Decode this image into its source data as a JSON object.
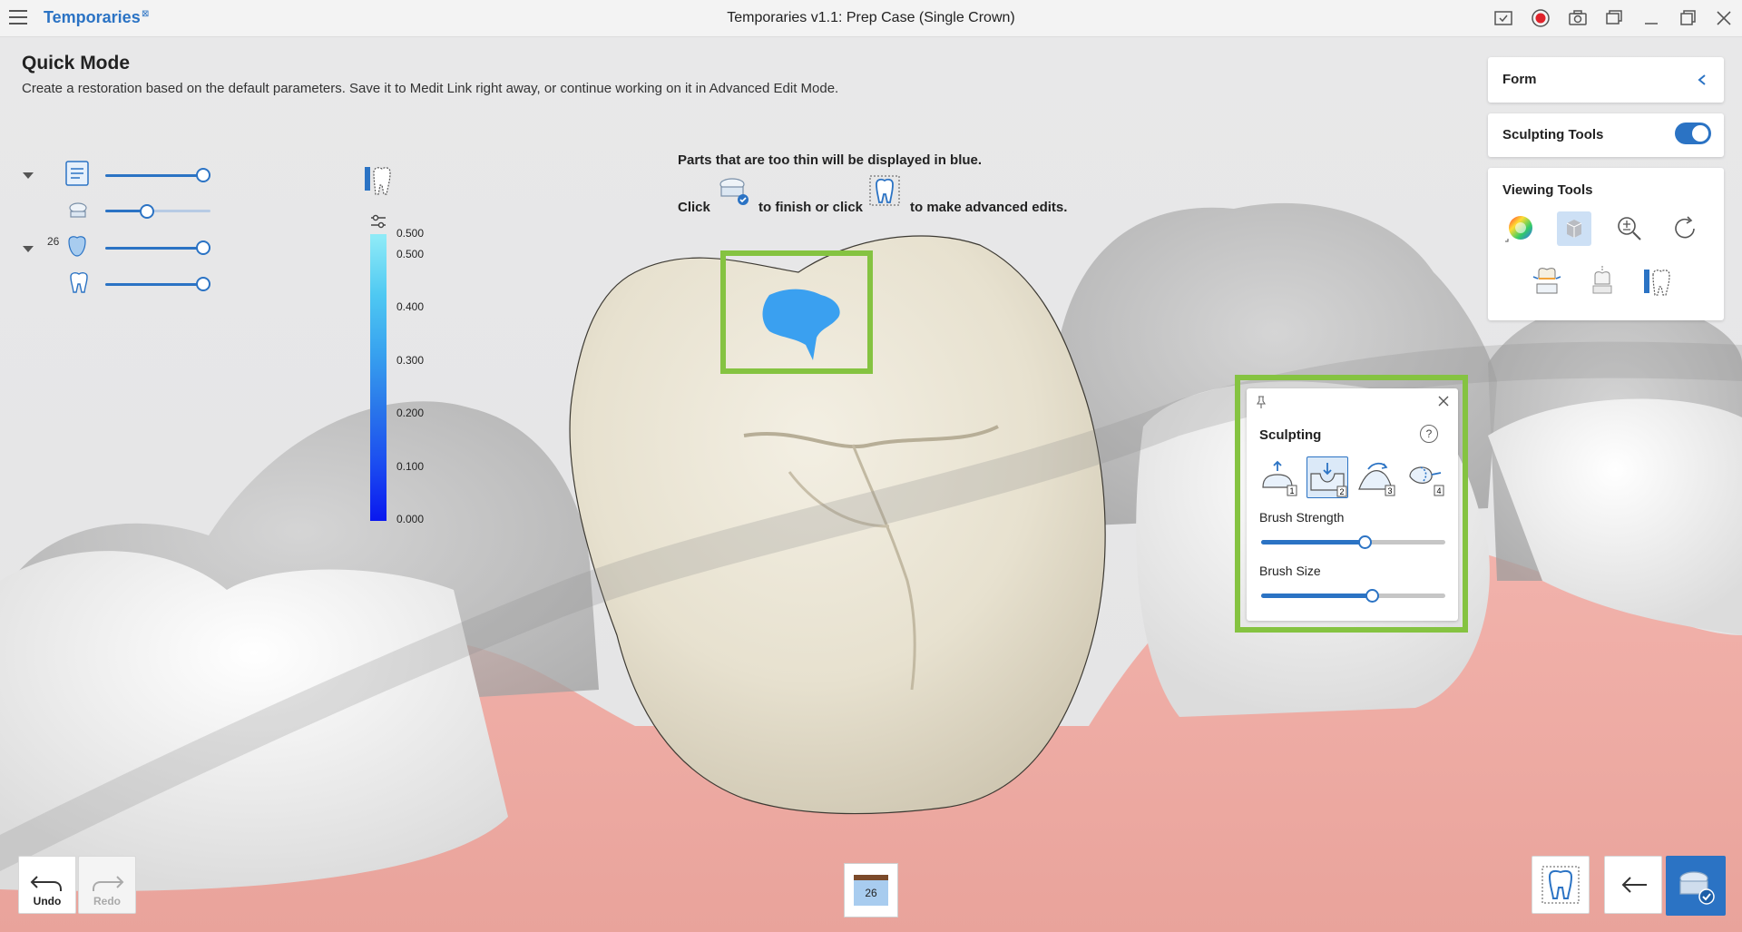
{
  "titlebar": {
    "app_name": "Temporaries",
    "app_mark": "⊠",
    "window_title": "Temporaries v1.1: Prep Case (Single Crown)"
  },
  "header": {
    "mode_title": "Quick Mode",
    "mode_description": "Create a restoration based on the default parameters. Save it to Medit Link right away, or continue working on it in Advanced Edit Mode."
  },
  "layers": {
    "tooth_number": "26",
    "items": [
      {
        "name": "design",
        "level": 1.0
      },
      {
        "name": "prep",
        "level": 0.4
      },
      {
        "name": "crown",
        "level": 1.0
      },
      {
        "name": "tooth",
        "level": 1.0
      }
    ]
  },
  "legend": {
    "labels": [
      "0.500",
      "0.500",
      "0.400",
      "0.300",
      "0.200",
      "0.100",
      "0.000"
    ]
  },
  "instructions": {
    "line1": "Parts that are too thin will be displayed in blue.",
    "click": "Click",
    "finish": "to finish or click",
    "advanced": "to make advanced edits."
  },
  "right_panel": {
    "form_label": "Form",
    "sculpting_tools_label": "Sculpting Tools",
    "sculpting_tools_on": true,
    "viewing_tools_label": "Viewing Tools"
  },
  "sculpting": {
    "title": "Sculpting",
    "help": "?",
    "tools": [
      {
        "icon": "add-material-icon",
        "key": "1"
      },
      {
        "icon": "remove-material-icon",
        "key": "2",
        "active": true
      },
      {
        "icon": "smooth-icon",
        "key": "3"
      },
      {
        "icon": "morph-icon",
        "key": "4"
      }
    ],
    "brush_strength_label": "Brush Strength",
    "brush_strength": 0.56,
    "brush_size_label": "Brush Size",
    "brush_size": 0.6
  },
  "bottom": {
    "undo_label": "Undo",
    "redo_label": "Redo",
    "tooth_tab": "26"
  },
  "colors": {
    "accent": "#2b73c4",
    "highlight": "#85c341",
    "thin_area": "#3aa0f0"
  }
}
